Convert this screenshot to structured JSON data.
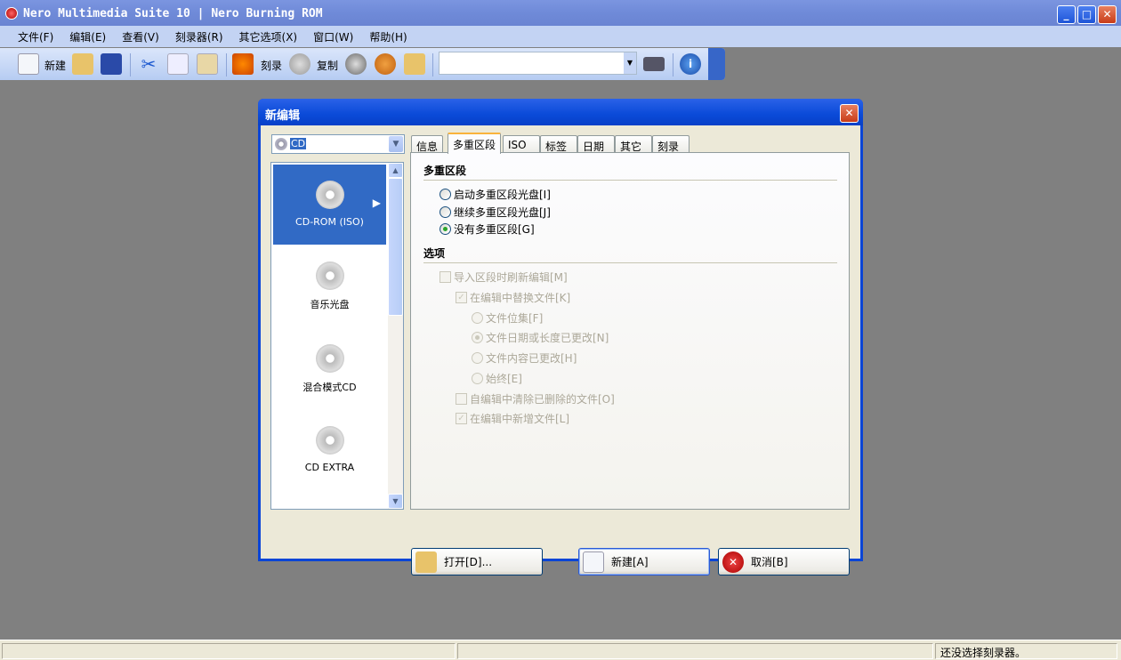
{
  "app": {
    "title": "Nero Multimedia Suite 10 | Nero Burning ROM"
  },
  "menu": [
    "文件(F)",
    "编辑(E)",
    "查看(V)",
    "刻录器(R)",
    "其它选项(X)",
    "窗口(W)",
    "帮助(H)"
  ],
  "toolbar": {
    "new_label": "新建",
    "burn_label": "刻录",
    "copy_label": "复制",
    "combo_value": ""
  },
  "status": {
    "text": "还没选择刻录器。"
  },
  "dialog": {
    "title": "新编辑",
    "disc_type": "CD",
    "disc_list": [
      "CD-ROM (ISO)",
      "音乐光盘",
      "混合模式CD",
      "CD EXTRA"
    ],
    "selected_index": 0,
    "tabs": [
      "信息",
      "多重区段",
      "ISO",
      "标签",
      "日期",
      "其它",
      "刻录"
    ],
    "active_tab": "多重区段",
    "multisession": {
      "heading": "多重区段",
      "options": [
        {
          "label": "启动多重区段光盘[I]",
          "checked": false
        },
        {
          "label": "继续多重区段光盘[J]",
          "checked": false
        },
        {
          "label": "没有多重区段[G]",
          "checked": true
        }
      ]
    },
    "options": {
      "heading": "选项",
      "refresh": {
        "label": "导入区段时刷新编辑[M]",
        "checked": false,
        "disabled": true
      },
      "replace": {
        "label": "在编辑中替换文件[K]",
        "checked": true,
        "disabled": true
      },
      "replace_modes": [
        {
          "label": "文件位集[F]",
          "checked": false
        },
        {
          "label": "文件日期或长度已更改[N]",
          "checked": true
        },
        {
          "label": "文件内容已更改[H]",
          "checked": false
        },
        {
          "label": "始终[E]",
          "checked": false
        }
      ],
      "remove_deleted": {
        "label": "自编辑中清除已删除的文件[O]",
        "checked": false,
        "disabled": true
      },
      "add_new": {
        "label": "在编辑中新增文件[L]",
        "checked": true,
        "disabled": true
      }
    },
    "buttons": {
      "open": "打开[D]...",
      "new": "新建[A]",
      "cancel": "取消[B]"
    }
  }
}
